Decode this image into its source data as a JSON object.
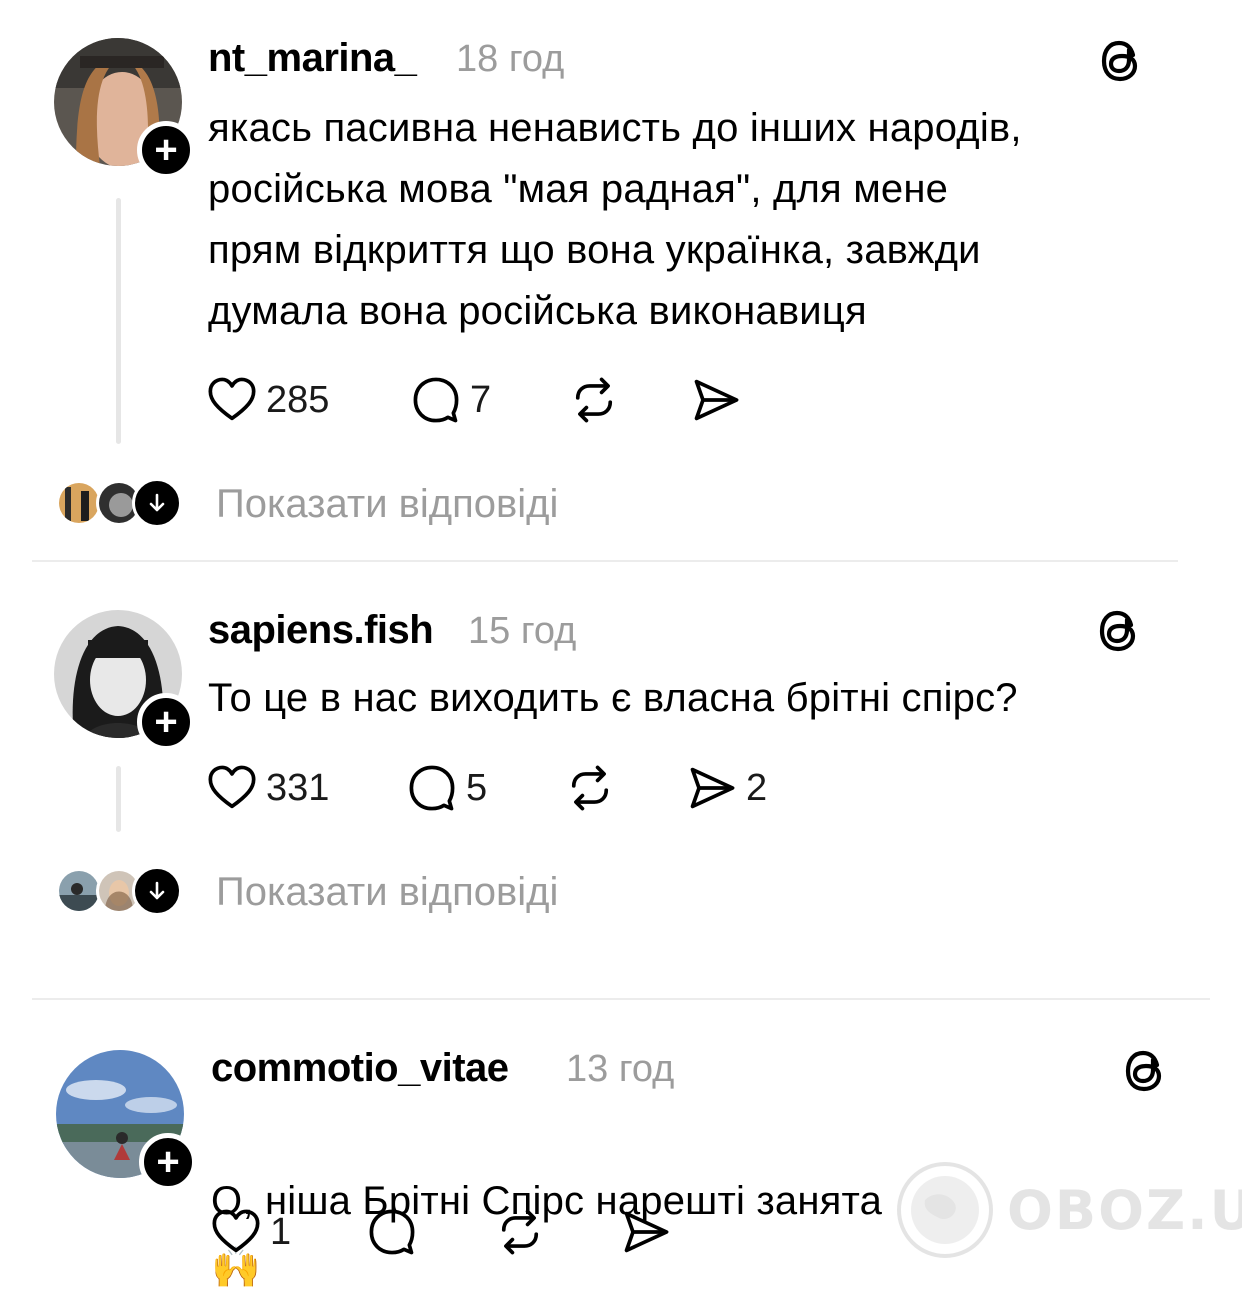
{
  "posts": [
    {
      "username": "nt_marina_",
      "time": "18 год",
      "text": "якась пасивна ненависть до інших народів,\nросійська мова \"мая радная\", для мене\nпрям відкриття що вона українка, завжди\nдумала вона російська виконавиця",
      "likes": "285",
      "replies": "7",
      "shares": "",
      "show_replies": "Показати відповіді"
    },
    {
      "username": "sapiens.fish",
      "time": "15 год",
      "text": "То це в нас виходить є власна брітні спірс?",
      "likes": "331",
      "replies": "5",
      "shares": "2",
      "show_replies": "Показати відповіді"
    },
    {
      "username": "commotio_vitae",
      "time": "13 год",
      "text": "О, ніша Брітні Спірс нарешті занята",
      "emoji": "🙌",
      "likes": "1",
      "replies": "",
      "shares": ""
    }
  ],
  "icons": {
    "like": "heart-outline-icon",
    "reply": "speech-bubble-icon",
    "repost": "repost-arrows-icon",
    "share": "paper-plane-icon",
    "threads": "threads-logo-icon",
    "follow": "plus-icon",
    "expand": "arrow-down-icon"
  },
  "watermark": "OBOZ.UA",
  "colors": {
    "text": "#000000",
    "muted": "#9c9c9c",
    "divider": "#ececec"
  }
}
